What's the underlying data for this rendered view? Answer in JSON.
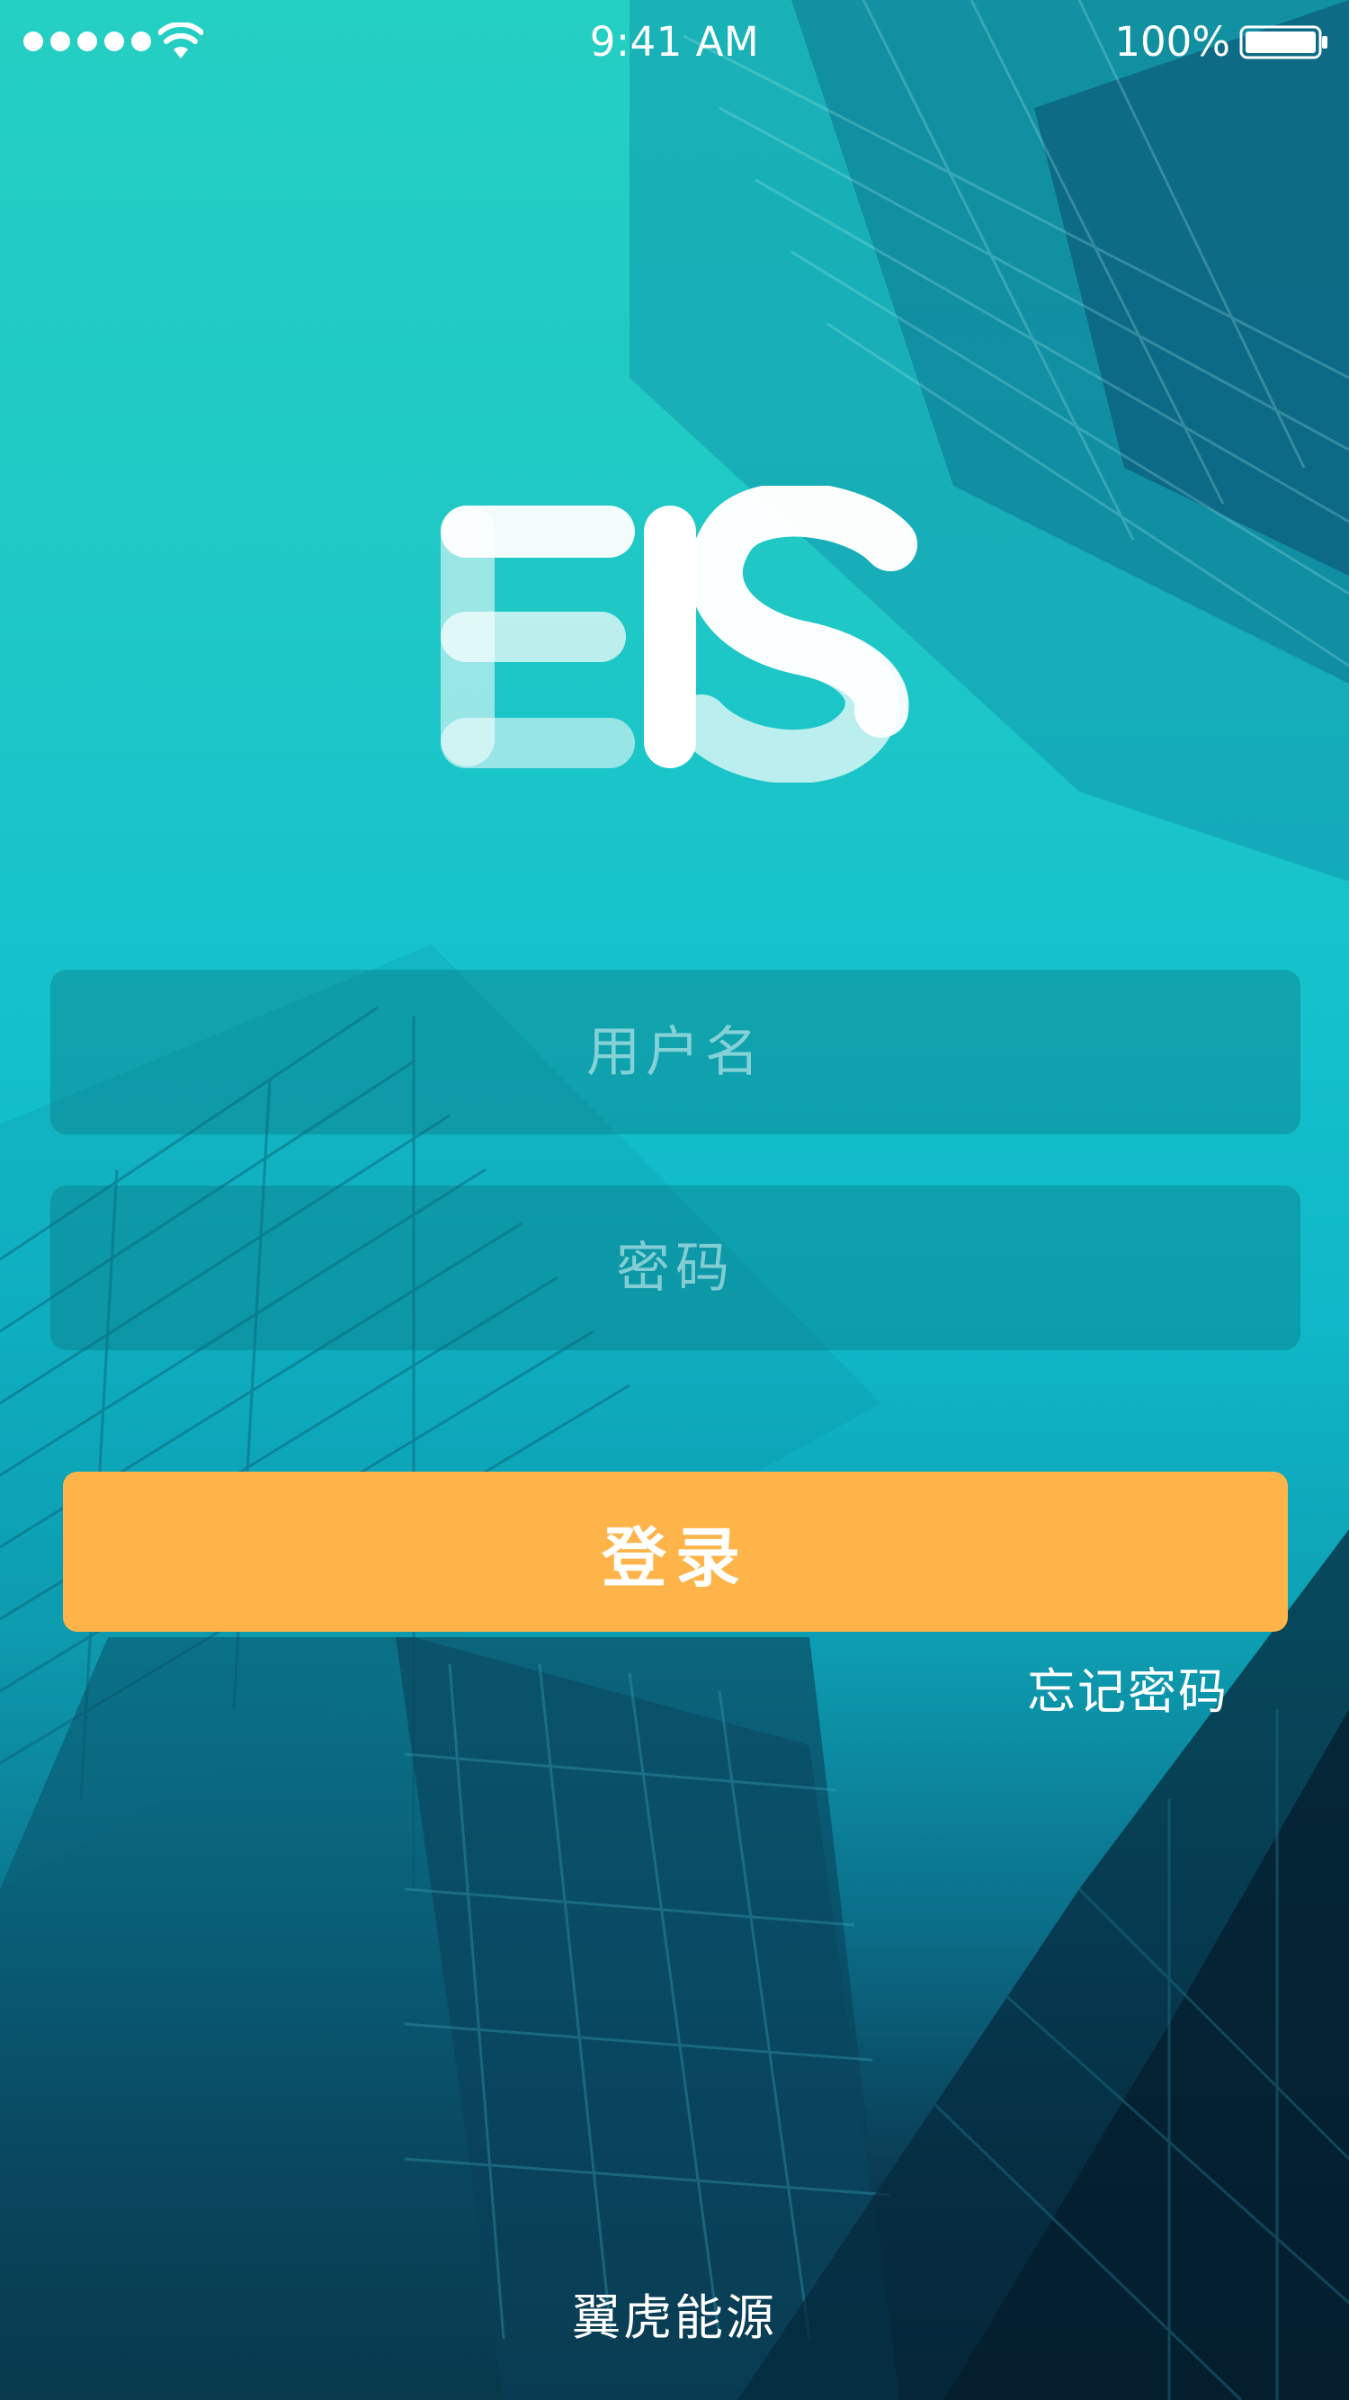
{
  "status_bar": {
    "time": "9:41 AM",
    "battery": "100%",
    "icons": [
      "signal-dots-icon",
      "wifi-icon",
      "battery-icon"
    ]
  },
  "logo": {
    "text": "EIS"
  },
  "login_form": {
    "username_placeholder": "用户名",
    "username_value": "",
    "password_placeholder": "密码",
    "password_value": "",
    "login_label": "登录",
    "forgot_label": "忘记密码"
  },
  "footer": {
    "brand": "翼虎能源"
  },
  "colors": {
    "background_top": "#24cfc3",
    "background_bottom": "#071d2c",
    "button": "#feb448",
    "text": "#ffffff"
  }
}
